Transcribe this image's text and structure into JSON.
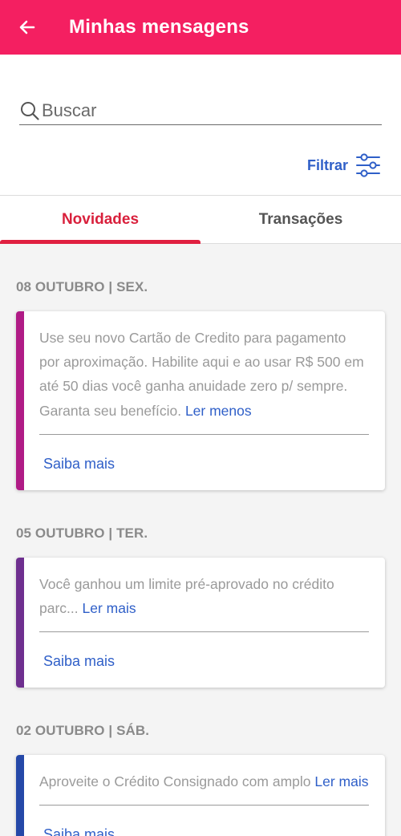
{
  "header": {
    "title": "Minhas mensagens",
    "color": "#f41f61"
  },
  "search": {
    "placeholder": "Buscar",
    "value": ""
  },
  "filter": {
    "label": "Filtrar"
  },
  "tabs": [
    {
      "label": "Novidades",
      "active": true
    },
    {
      "label": "Transações",
      "active": false
    }
  ],
  "messages": [
    {
      "date": "08 OUTUBRO | SEX.",
      "text": "Use seu novo Cartão de Credito para pagamento por aproximação. Habilite aqui e ao usar R$ 500 em até 50 dias você ganha anuidade zero p/ sempre. Garanta seu benefício.",
      "toggle": "Ler menos",
      "action": "Saiba mais",
      "accent": "#b01b86"
    },
    {
      "date": "05 OUTUBRO | TER.",
      "text": "Você ganhou um limite pré-aprovado no crédito parc...",
      "toggle": "Ler mais",
      "action": "Saiba mais",
      "accent": "#6e2f8f"
    },
    {
      "date": "02 OUTUBRO | SÁB.",
      "text": "Aproveite o Crédito Consignado com amplo",
      "toggle": "Ler mais",
      "action": "Saiba mais",
      "accent": "#2548a8"
    }
  ]
}
